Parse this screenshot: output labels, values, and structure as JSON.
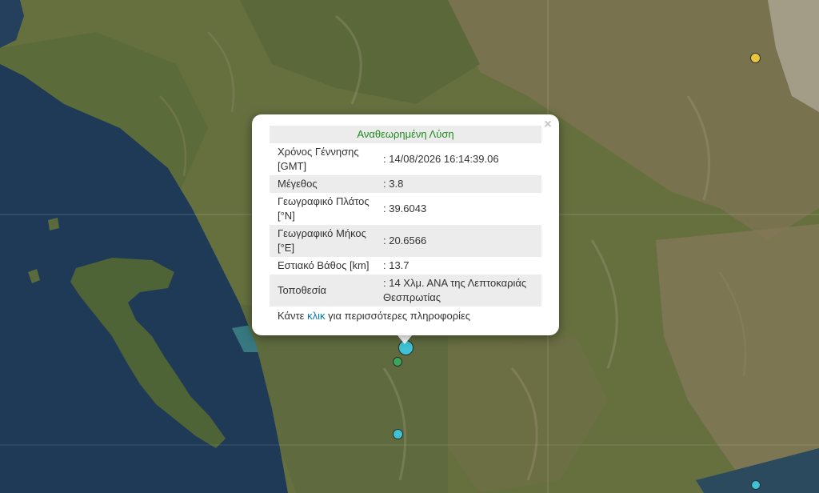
{
  "popup": {
    "title": "Αναθεωρημένη Λύση",
    "close_symbol": "×",
    "rows": [
      {
        "label": "Χρόνος Γέννησης [GMT]",
        "value": ": 14/08/2026 16:14:39.06"
      },
      {
        "label": "Μέγεθος",
        "value": ": 3.8"
      },
      {
        "label": "Γεωγραφικό Πλάτος [°N]",
        "value": ": 39.6043"
      },
      {
        "label": "Γεωγραφικό Μήκος [°E]",
        "value": ": 20.6566"
      },
      {
        "label": "Εστιακό Βάθος [km]",
        "value": ": 13.7"
      },
      {
        "label": "Τοποθεσία",
        "value": ": 14 Χλμ. ΑΝΑ της Λεπτοκαριάς Θεσπρωτίας"
      }
    ],
    "more_prefix": "Κάντε ",
    "more_link": "κλικ",
    "more_suffix": " για περισσότερες πληροφορίες"
  },
  "markers": [
    {
      "name": "earthquake-marker-selected",
      "color": "#3ec3d6"
    },
    {
      "name": "earthquake-marker-green",
      "color": "#3aa65a"
    },
    {
      "name": "earthquake-marker-cyan-south",
      "color": "#3ec3d6"
    },
    {
      "name": "earthquake-marker-yellow",
      "color": "#e8c53a"
    },
    {
      "name": "earthquake-marker-cyan-southeast",
      "color": "#3ec3d6"
    }
  ],
  "colors": {
    "sea": "#1f3a56",
    "land": "#5c6b40",
    "highland": "#7d7453",
    "title_green": "#1f8a1f",
    "link": "#0078a8"
  }
}
